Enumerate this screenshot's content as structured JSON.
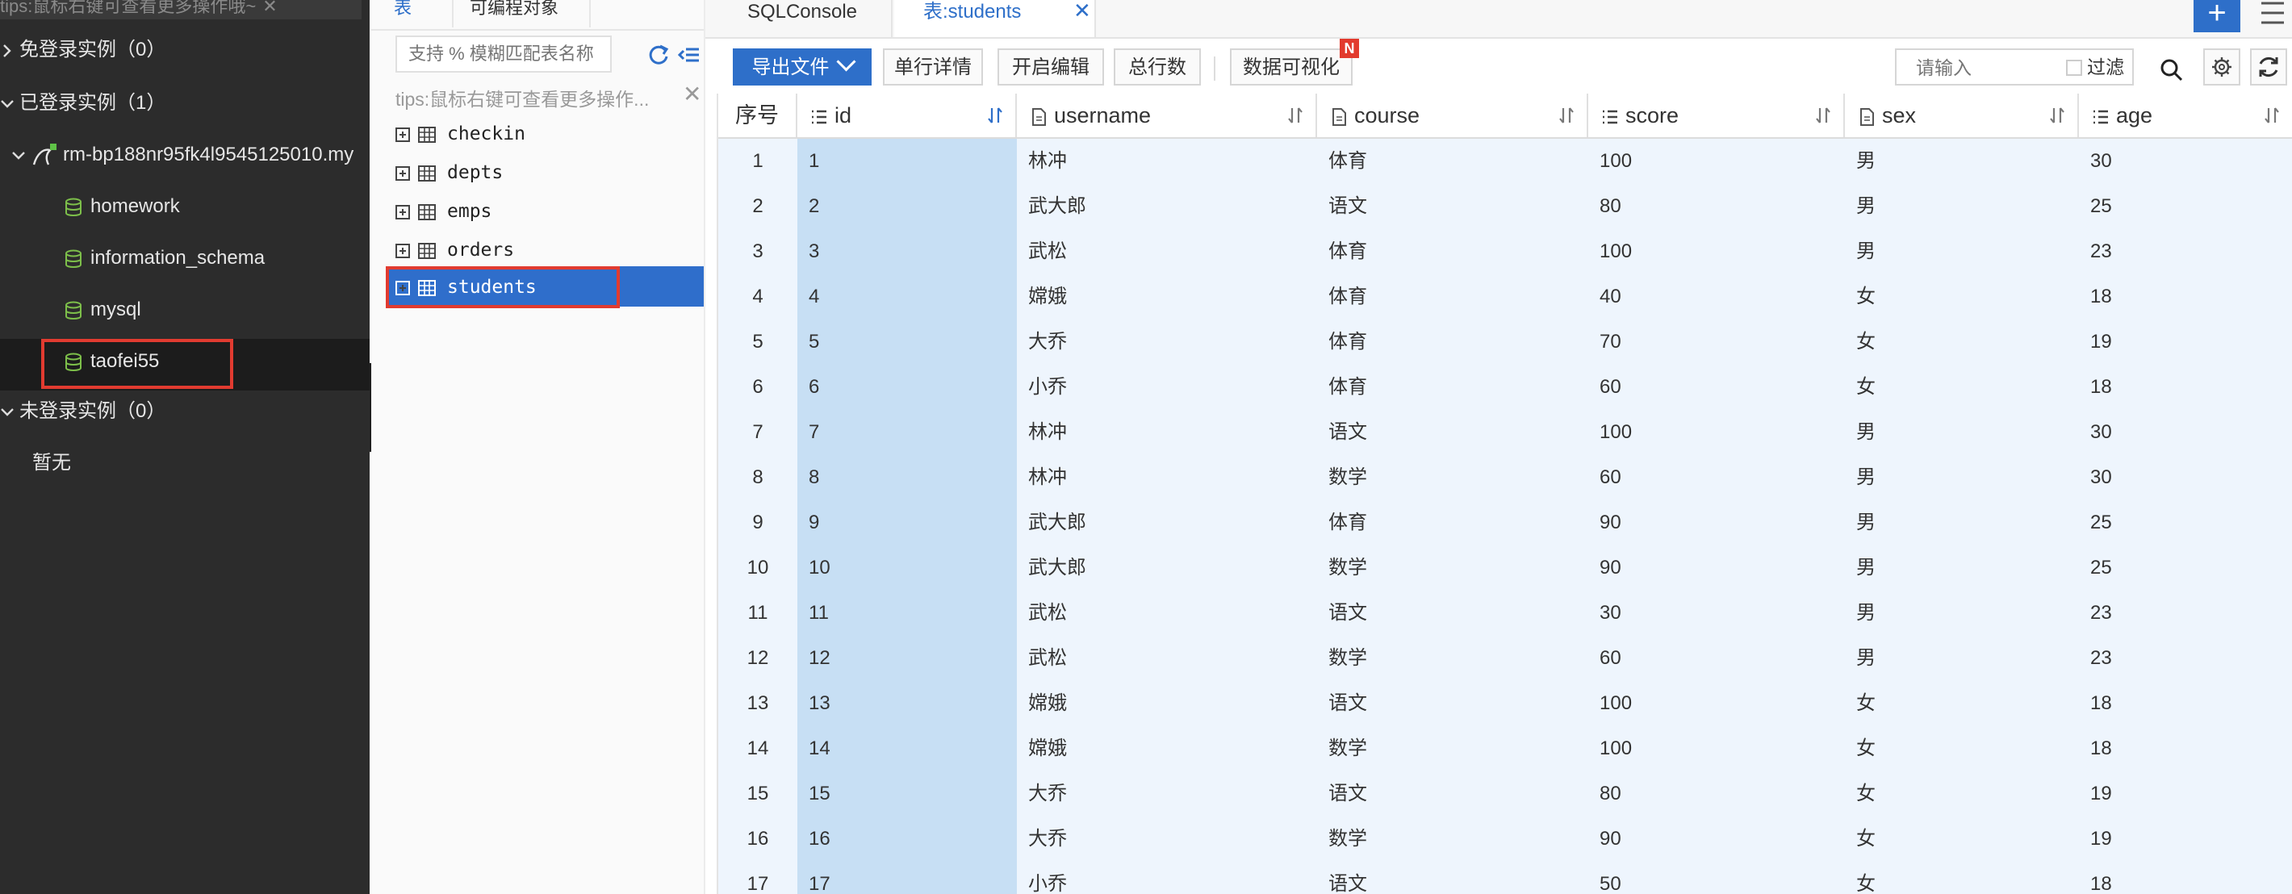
{
  "sidebar": {
    "tip": "tips:鼠标右键可查看更多操作哦~",
    "groups": {
      "free_login": "免登录实例（0）",
      "logged_in": "已登录实例（1）",
      "not_logged_in": "未登录实例（0）"
    },
    "instance": "rm-bp188nr95fk4l9545125010.my",
    "databases": [
      "homework",
      "information_schema",
      "mysql",
      "taofei55"
    ],
    "empty_text": "暂无"
  },
  "tables_panel": {
    "tabs": [
      "表",
      "可编程对象"
    ],
    "search_placeholder": "支持 % 模糊匹配表名称",
    "tip": "tips:鼠标右键可查看更多操作...",
    "tables": [
      "checkin",
      "depts",
      "emps",
      "orders",
      "students"
    ],
    "selected_table": "students"
  },
  "editor_tabs": {
    "sql_console": "SQLConsole",
    "active_tab": "表:students"
  },
  "toolbar": {
    "export": "导出文件",
    "row_detail": "单行详情",
    "start_edit": "开启编辑",
    "total_rows": "总行数",
    "visualize": "数据可视化",
    "new_badge": "N",
    "filter_placeholder": "请输入",
    "filter_label": "过滤"
  },
  "grid": {
    "columns": [
      "序号",
      "id",
      "username",
      "course",
      "score",
      "sex",
      "age"
    ],
    "rows": [
      [
        "1",
        "1",
        "林冲",
        "体育",
        "100",
        "男",
        "30"
      ],
      [
        "2",
        "2",
        "武大郎",
        "语文",
        "80",
        "男",
        "25"
      ],
      [
        "3",
        "3",
        "武松",
        "体育",
        "100",
        "男",
        "23"
      ],
      [
        "4",
        "4",
        "嫦娥",
        "体育",
        "40",
        "女",
        "18"
      ],
      [
        "5",
        "5",
        "大乔",
        "体育",
        "70",
        "女",
        "19"
      ],
      [
        "6",
        "6",
        "小乔",
        "体育",
        "60",
        "女",
        "18"
      ],
      [
        "7",
        "7",
        "林冲",
        "语文",
        "100",
        "男",
        "30"
      ],
      [
        "8",
        "8",
        "林冲",
        "数学",
        "60",
        "男",
        "30"
      ],
      [
        "9",
        "9",
        "武大郎",
        "体育",
        "90",
        "男",
        "25"
      ],
      [
        "10",
        "10",
        "武大郎",
        "数学",
        "90",
        "男",
        "25"
      ],
      [
        "11",
        "11",
        "武松",
        "语文",
        "30",
        "男",
        "23"
      ],
      [
        "12",
        "12",
        "武松",
        "数学",
        "60",
        "男",
        "23"
      ],
      [
        "13",
        "13",
        "嫦娥",
        "语文",
        "100",
        "女",
        "18"
      ],
      [
        "14",
        "14",
        "嫦娥",
        "数学",
        "100",
        "女",
        "18"
      ],
      [
        "15",
        "15",
        "大乔",
        "语文",
        "80",
        "女",
        "19"
      ],
      [
        "16",
        "16",
        "大乔",
        "数学",
        "90",
        "女",
        "19"
      ],
      [
        "17",
        "17",
        "小乔",
        "语文",
        "50",
        "女",
        "18"
      ]
    ]
  },
  "colors": {
    "sidebar_bg": "#2c2c2c",
    "accent": "#2e6fc9",
    "highlight_border": "#e13b30",
    "db_icon": "#7dbf4a",
    "row_bg": "#eef5fd",
    "id_col_bg": "#c7dff4"
  }
}
